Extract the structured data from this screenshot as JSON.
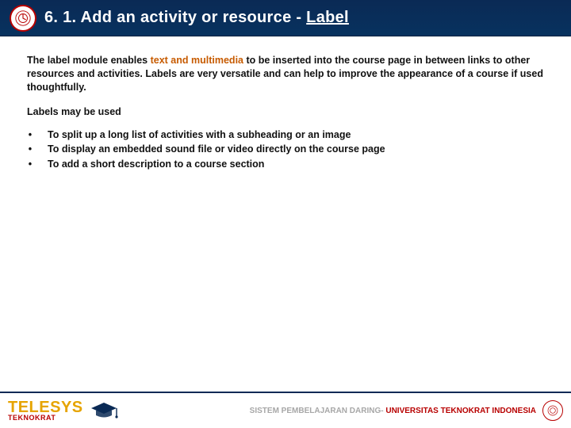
{
  "header": {
    "title_prefix": "6. 1. Add an activity or resource - ",
    "title_label": "Label"
  },
  "intro": {
    "pre": "The label module enables ",
    "highlight": "text and multimedia",
    "post": " to be inserted into the course page in between links to other resources and activities. Labels are very versatile and can help to improve the appearance of a course if used thoughtfully."
  },
  "subheading": "Labels may be used",
  "bullets": [
    "To split up a long list of activities with a subheading or an image",
    "To display an embedded sound file or video directly on the course page",
    "To add a short description to a course section"
  ],
  "footer": {
    "brand_big": "TELESYS",
    "brand_small": "TEKNOKRAT",
    "tagline_gray": "SISTEM PEMBELAJARAN DARING- ",
    "tagline_red": "UNIVERSITAS TEKNOKRAT INDONESIA"
  }
}
